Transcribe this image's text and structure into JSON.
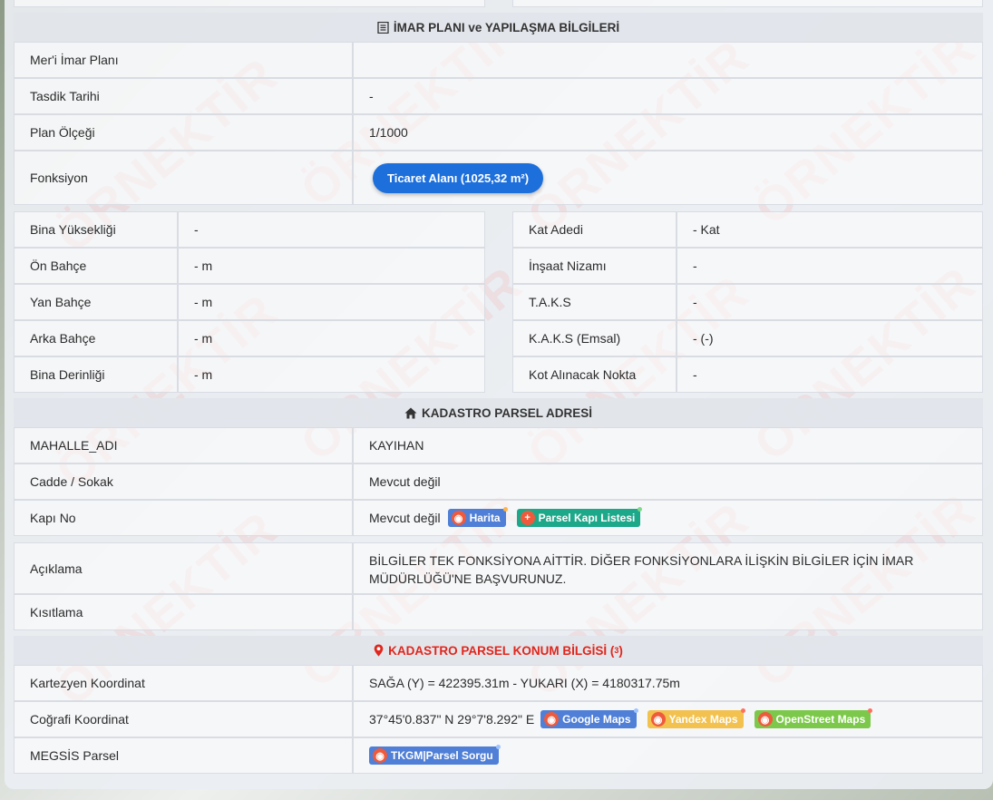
{
  "imar": {
    "section_title": "İMAR PLANI ve YAPILAŞMA BİLGİLERİ",
    "rows": [
      {
        "label": "Mer'i İmar Planı",
        "value": ""
      },
      {
        "label": "Tasdik Tarihi",
        "value": "-"
      },
      {
        "label": "Plan Ölçeği",
        "value": "1/1000"
      }
    ],
    "fonksiyon_label": "Fonksiyon",
    "fonksiyon_button": "Ticaret Alanı (1025,32 m²)"
  },
  "yapi_left": [
    {
      "label": "Bina Yüksekliği",
      "value": "-"
    },
    {
      "label": "Ön Bahçe",
      "value": "- m"
    },
    {
      "label": "Yan Bahçe",
      "value": "- m"
    },
    {
      "label": "Arka Bahçe",
      "value": "- m"
    },
    {
      "label": "Bina Derinliği",
      "value": "- m"
    }
  ],
  "yapi_right": [
    {
      "label": "Kat Adedi",
      "value": "- Kat"
    },
    {
      "label": "İnşaat Nizamı",
      "value": "-"
    },
    {
      "label": "T.A.K.S",
      "value": "-"
    },
    {
      "label": "K.A.K.S (Emsal)",
      "value": "- (-)"
    },
    {
      "label": "Kot Alınacak Nokta",
      "value": "-"
    }
  ],
  "adres": {
    "section_title": "KADASTRO PARSEL ADRESİ",
    "rows": [
      {
        "label": "MAHALLE_ADI",
        "value": "KAYIHAN"
      },
      {
        "label": "Cadde / Sokak",
        "value": "Mevcut değil"
      }
    ],
    "kapi_label": "Kapı No",
    "kapi_value": "Mevcut değil",
    "harita_badge": "Harita",
    "kapi_listesi_badge": "Parsel Kapı Listesi"
  },
  "aciklama": {
    "label": "Açıklama",
    "value": "BİLGİLER TEK FONKSİYONA AİTTİR. DİĞER FONKSİYONLARA İLİŞKİN BİLGİLER İÇİN İMAR MÜDÜRLÜĞÜ'NE BAŞVURUNUZ.",
    "kisitlama_label": "Kısıtlama",
    "kisitlama_value": ""
  },
  "konum": {
    "section_title": "KADASTRO PARSEL KONUM BİLGİSİ (",
    "section_sup": "3",
    "section_close": ")",
    "kartezyen_label": "Kartezyen Koordinat",
    "kartezyen_value": "SAĞA (Y) = 422395.31m - YUKARI (X) = 4180317.75m",
    "cografi_label": "Coğrafi Koordinat",
    "cografi_value": "37°45'0.837\" N 29°7'8.292\" E",
    "google_badge": "Google Maps",
    "yandex_badge": "Yandex Maps",
    "osm_badge": "OpenStreet Maps",
    "megsis_label": "MEGSİS Parsel",
    "tkgm_badge": "TKGM|Parsel Sorgu"
  },
  "watermark": "ÖRNEKTİR",
  "colors": {
    "primary_button": "#1d6fdc",
    "accent_red": "#e1261c"
  }
}
